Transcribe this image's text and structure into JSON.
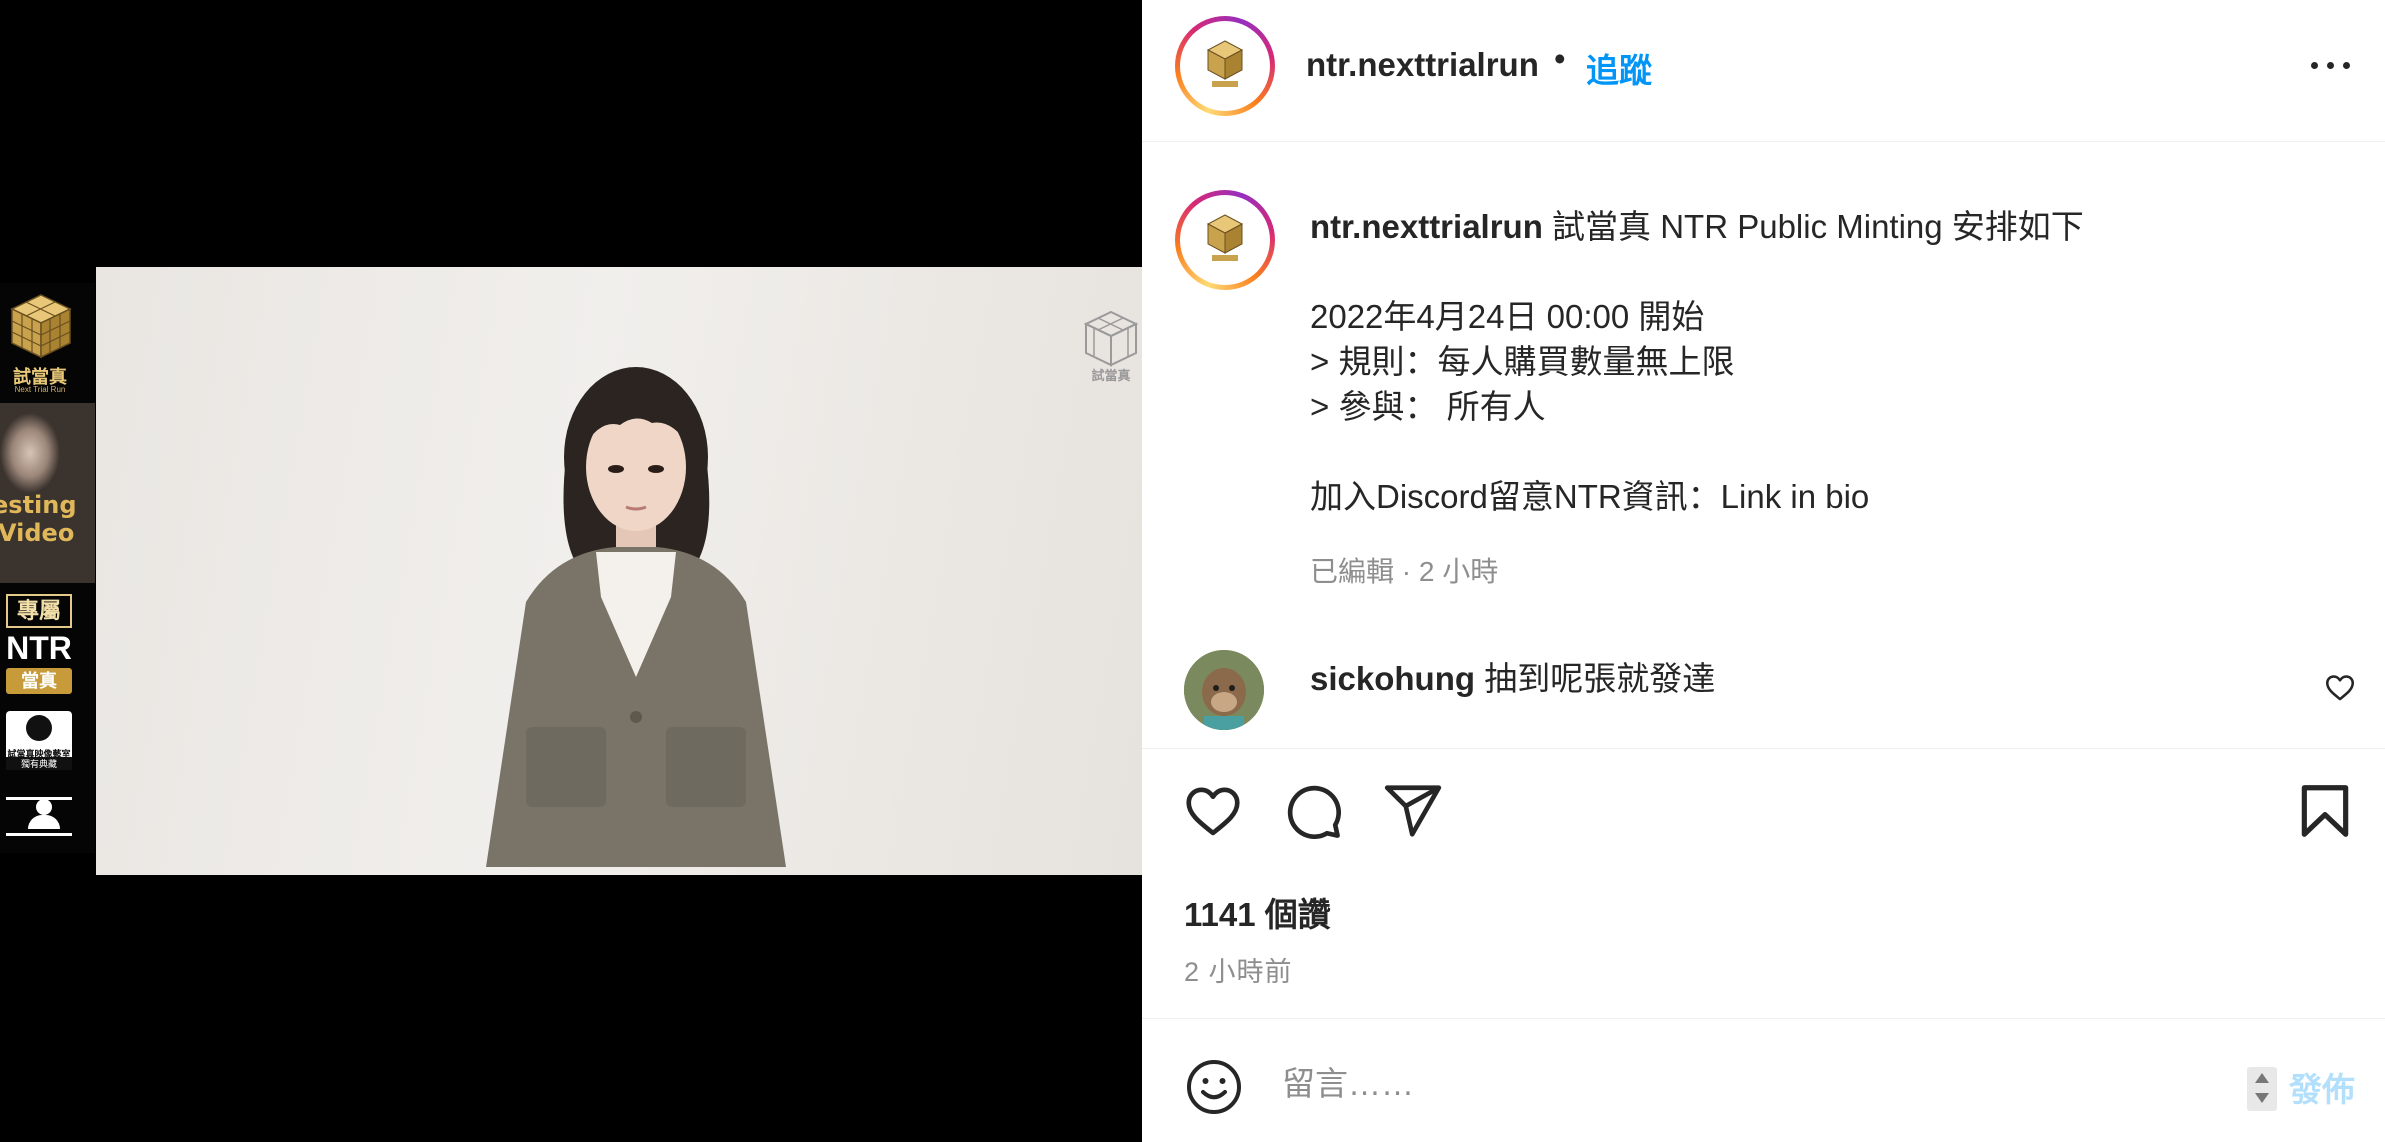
{
  "media": {
    "sidebar": {
      "logo_label": "試當真",
      "logo_sub": "Next Trial Run",
      "video_label_line1": "esting",
      "video_label_line2": "Video",
      "exclusive": "專屬",
      "ntr": "NTR",
      "gold_label": "當真",
      "cert_label": "試當真映像藝室",
      "cert_label2": "獨有典藏"
    },
    "watermark": "試當真"
  },
  "header": {
    "username": "ntr.nexttrialrun",
    "dot": "•",
    "follow_label": "追蹤"
  },
  "caption": {
    "username": "ntr.nexttrialrun",
    "text": " 試當真 NTR Public Minting 安排如下\n\n2022年4月24日 00:00 開始\n> 規則：每人購買數量無上限\n> 參與： 所有人\n\n加入Discord留意NTR資訊：Link in bio",
    "meta": "已編輯 · 2 小時"
  },
  "comment": {
    "username": "sickohung",
    "text": " 抽到呢張就發達"
  },
  "stats": {
    "likes": "1141 個讚",
    "time": "2 小時前"
  },
  "add_comment": {
    "placeholder": "留言……",
    "post_label": "發佈"
  },
  "colors": {
    "link_blue": "#0095f6",
    "post_disabled": "#b2dffc",
    "secondary_text": "#8e8e8e"
  }
}
